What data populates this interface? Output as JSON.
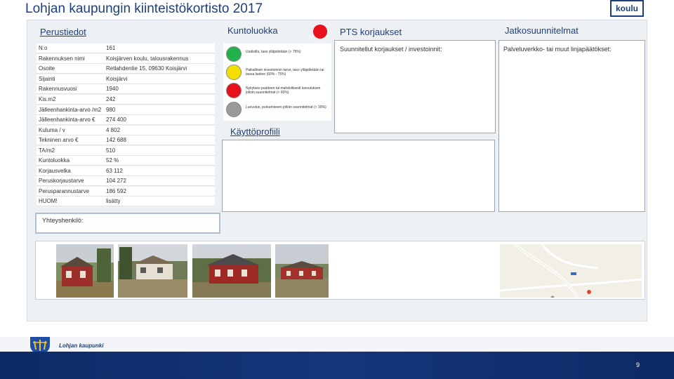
{
  "header": {
    "title": "Lohjan kaupungin kiinteistökortisto 2017",
    "type_badge": "koulu"
  },
  "basic_info": {
    "heading": "Perustiedot",
    "rows": [
      {
        "label": "N:o",
        "value": "161"
      },
      {
        "label": "Rakennuksen nimi",
        "value": "Koisjärven koulu, talousrakennus"
      },
      {
        "label": "Osoite",
        "value": "Retlahdentie 15, 09630 Koisjärvi"
      },
      {
        "label": "Sijainti",
        "value": "Koisjärvi"
      },
      {
        "label": "Rakennusvuosi",
        "value": "1940"
      },
      {
        "label": "Kis.m2",
        "value": "242"
      },
      {
        "label": "Jälleenhankinta-arvo /m2",
        "value": "980"
      },
      {
        "label": "Jälleenhankinta-arvo €",
        "value": "274 400"
      },
      {
        "label": "Kuluma / v",
        "value": "4 802"
      },
      {
        "label": "Tekninen arvo €",
        "value": "142 688"
      },
      {
        "label": "TA/m2",
        "value": "510"
      },
      {
        "label": "Kuntoluokka",
        "value": "52 %"
      },
      {
        "label": "Korjausvelka",
        "value": "63 112"
      },
      {
        "label": "Peruskorjaustarve",
        "value": "104 272"
      },
      {
        "label": "Perusparannustarve",
        "value": "186 592"
      },
      {
        "label": "HUOM!",
        "value": "lisätty"
      }
    ]
  },
  "condition": {
    "heading": "Kuntoluokka",
    "current_color": "#e8101a",
    "legend": [
      {
        "color": "#22b14c",
        "text": "Uudistila, taso ylläpidetään (> 75%)"
      },
      {
        "color": "#f4e000",
        "text": "Paikallinen investoinnin tarve, taso ylläpidetään tai tasoa laskee (60% - 75%)"
      },
      {
        "color": "#e8101a",
        "text": "Nykytaso puutteen tai mahdollisesti luovutuksen jolloin suunnitelmat (< 60%)"
      },
      {
        "color": "#9a9a9a",
        "text": "Luovutus, purkamiseen jolloin suunnitelmat (< 30%)"
      }
    ]
  },
  "repairs": {
    "heading": "PTS korjaukset",
    "subheading": "Suunnitellut korjaukset / investoinnit:"
  },
  "plans": {
    "heading": "Jatkosuunnitelmat",
    "subheading": "Palveluverkko- tai muut linjapäätökset:"
  },
  "usage_profile": {
    "heading": "Käyttöprofiili"
  },
  "contact": {
    "label": "Yhteyshenkilö:"
  },
  "footer": {
    "brand": "Lohjan kaupunki",
    "page_number": "9"
  }
}
